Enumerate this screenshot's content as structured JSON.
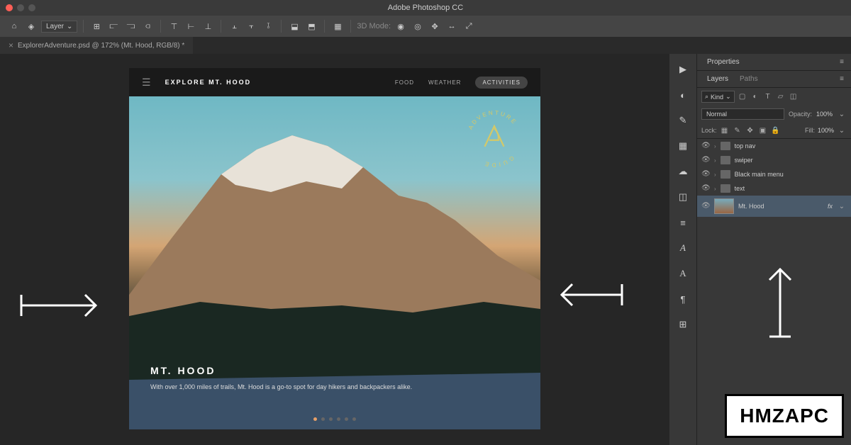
{
  "app_title": "Adobe Photoshop CC",
  "menubar": {
    "layer_label": "Layer",
    "mode_label": "3D Mode:"
  },
  "tab": {
    "name": "ExplorerAdventure.psd @ 172% (Mt. Hood, RGB/8) *"
  },
  "design": {
    "brand": "EXPLORE MT. HOOD",
    "nav": [
      "FOOD",
      "WEATHER",
      "ACTIVITIES"
    ],
    "badge_top": "ADVENTURE",
    "badge_bottom": "GUIDE",
    "hero_title": "MT. HOOD",
    "hero_sub": "With over 1,000 miles of trails, Mt. Hood is a go-to spot for day hikers and backpackers alike."
  },
  "panels": {
    "properties": "Properties",
    "layers": "Layers",
    "paths": "Paths",
    "kind": "Kind",
    "blend": "Normal",
    "opacity_label": "Opacity:",
    "opacity_val": "100%",
    "lock_label": "Lock:",
    "fill_label": "Fill:",
    "fill_val": "100%",
    "fx": "fx",
    "items": [
      {
        "name": "top nav",
        "type": "folder"
      },
      {
        "name": "swiper",
        "type": "folder"
      },
      {
        "name": "Black main menu",
        "type": "folder"
      },
      {
        "name": "text",
        "type": "folder"
      },
      {
        "name": "Mt. Hood",
        "type": "image"
      }
    ]
  },
  "watermark": "HMZAPC"
}
